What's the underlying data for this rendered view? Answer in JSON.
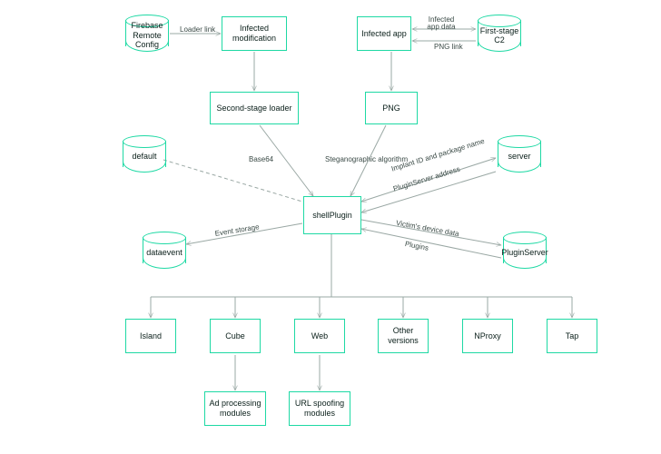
{
  "nodes": {
    "firebase": {
      "label": "Firebase\nRemote\nConfig"
    },
    "infectedMod": {
      "label": "Infected\nmodification"
    },
    "secondLoader": {
      "label": "Second-stage loader"
    },
    "infectedApp": {
      "label": "Infected app"
    },
    "firstStageC2": {
      "label": "First-stage\nC2"
    },
    "png": {
      "label": "PNG"
    },
    "default": {
      "label": "default"
    },
    "server": {
      "label": "server"
    },
    "dataevent": {
      "label": "dataevent"
    },
    "pluginServer": {
      "label": "PluginServer"
    },
    "shellPlugin": {
      "label": "shellPlugin"
    },
    "island": {
      "label": "Island"
    },
    "cube": {
      "label": "Cube"
    },
    "web": {
      "label": "Web"
    },
    "otherV": {
      "label": "Other\nversions"
    },
    "nproxy": {
      "label": "NProxy"
    },
    "tap": {
      "label": "Tap"
    },
    "adProc": {
      "label": "Ad processing\nmodules"
    },
    "urlSpoof": {
      "label": "URL spoofing\nmodules"
    }
  },
  "edges": {
    "loaderLink": {
      "label": "Loader link"
    },
    "infectedAppData": {
      "label": "Infected\napp data"
    },
    "pngLink": {
      "label": "PNG link"
    },
    "base64": {
      "label": "Base64"
    },
    "stego": {
      "label": "Steganographic algorithm"
    },
    "implantId": {
      "label": "Implant ID and package name"
    },
    "pluginAddr": {
      "label": "PluginServer address"
    },
    "eventStorage": {
      "label": "Event storage"
    },
    "victimData": {
      "label": "Victim's device data"
    },
    "plugins": {
      "label": "Plugins"
    }
  }
}
